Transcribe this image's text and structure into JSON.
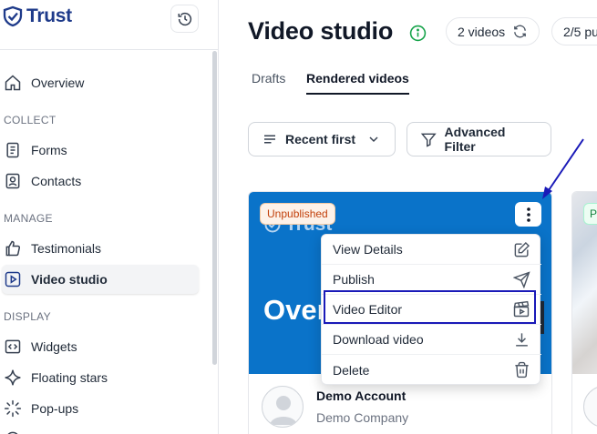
{
  "app": {
    "logo_text": "Trust"
  },
  "sidebar": {
    "items": [
      {
        "label": "Overview"
      },
      {
        "label": "Forms"
      },
      {
        "label": "Contacts"
      },
      {
        "label": "Testimonials"
      },
      {
        "label": "Video studio"
      },
      {
        "label": "Widgets"
      },
      {
        "label": "Floating stars"
      },
      {
        "label": "Pop-ups"
      }
    ],
    "sections": {
      "collect": "COLLECT",
      "manage": "MANAGE",
      "display": "DISPLAY"
    }
  },
  "header": {
    "title": "Video studio",
    "videos_pill": "2 videos",
    "usage_pill": "2/5 pu"
  },
  "tabs": [
    {
      "label": "Drafts"
    },
    {
      "label": "Rendered videos"
    }
  ],
  "toolbar": {
    "sort_label": "Recent first",
    "filter_label": "Advanced Filter"
  },
  "card": {
    "badge": "Unpublished",
    "thumb_logo": "Trust",
    "thumb_text": "Over",
    "account_name": "Demo Account",
    "company": "Demo Company"
  },
  "menu": {
    "items": [
      {
        "label": "View Details",
        "icon": "pencil-icon"
      },
      {
        "label": "Publish",
        "icon": "send-icon"
      },
      {
        "label": "Video Editor",
        "icon": "clapperboard-icon"
      },
      {
        "label": "Download video",
        "icon": "download-icon"
      },
      {
        "label": "Delete",
        "icon": "trash-icon"
      }
    ]
  },
  "card2": {
    "badge": "Pu"
  },
  "colors": {
    "brand": "#1e3a8a",
    "thumb_blue": "#0a73c9",
    "annotation": "#1a1ab8"
  }
}
